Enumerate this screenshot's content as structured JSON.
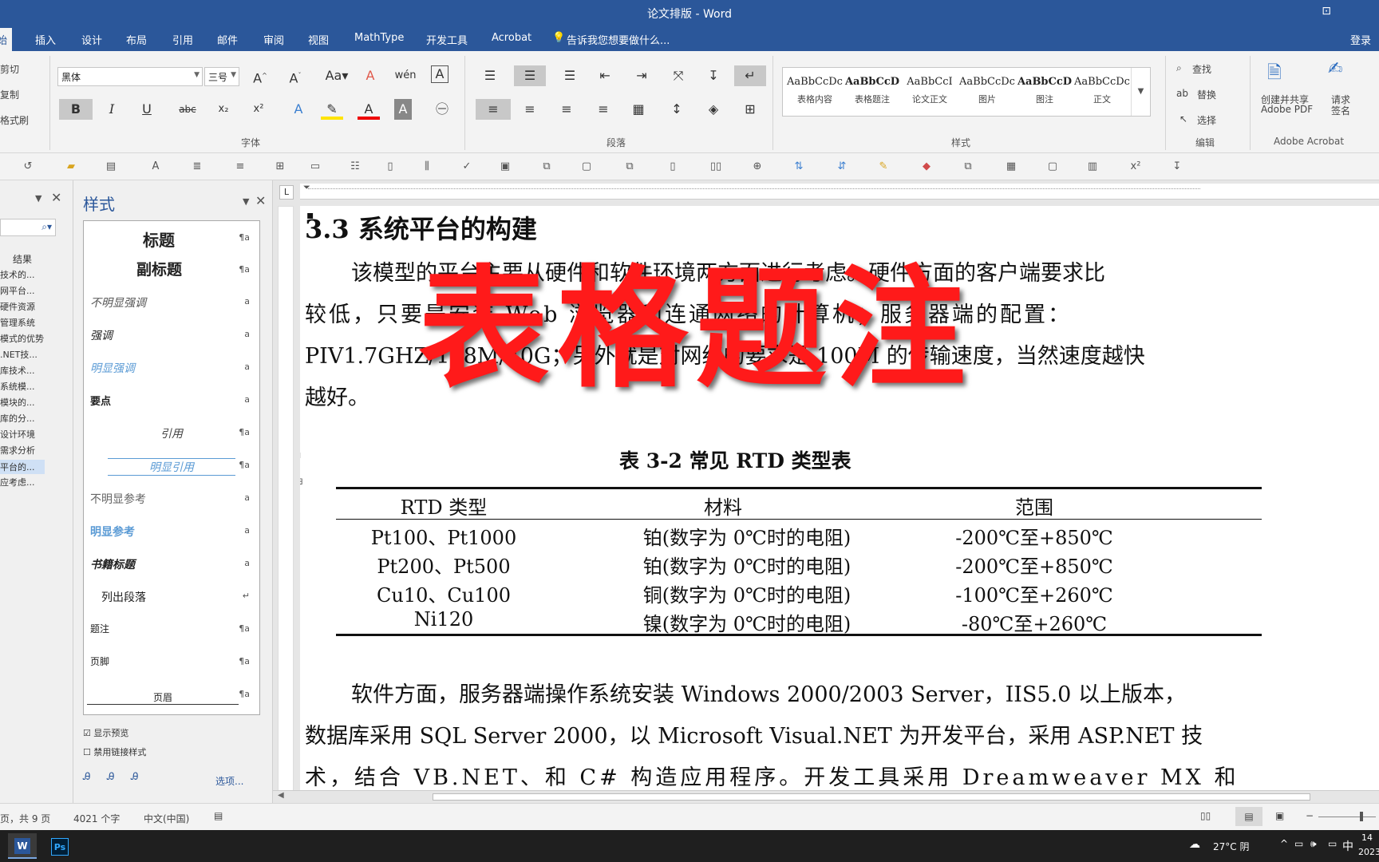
{
  "window": {
    "title": "论文排版 - Word"
  },
  "menu": {
    "items": [
      "始",
      "插入",
      "设计",
      "布局",
      "引用",
      "邮件",
      "审阅",
      "视图",
      "MathType",
      "开发工具",
      "Acrobat"
    ],
    "tell_me": "告诉我您想要做什么...",
    "login": "登录"
  },
  "ribbon": {
    "clipboard": {
      "cut": "剪切",
      "copy": "复制",
      "format_painter": "格式刷"
    },
    "font": {
      "name": "黑体",
      "size": "三号",
      "group_label": "字体",
      "bold": "B",
      "italic": "I",
      "underline": "U",
      "strike": "abc"
    },
    "paragraph": {
      "group_label": "段落"
    },
    "styles": {
      "group_label": "样式",
      "gallery": [
        {
          "preview": "AaBbCcDc",
          "name": "表格内容"
        },
        {
          "preview": "AaBbCcD",
          "name": "表格题注"
        },
        {
          "preview": "AaBbCcI",
          "name": "论文正文"
        },
        {
          "preview": "AaBbCcDc",
          "name": "图片"
        },
        {
          "preview": "AaBbCcD",
          "name": "图注"
        },
        {
          "preview": "AaBbCcDc",
          "name": "正文"
        }
      ]
    },
    "editing": {
      "find": "查找",
      "replace": "替换",
      "select": "选择",
      "group_label": "编辑"
    },
    "acrobat": {
      "create_share": "创建并共享",
      "create_share_2": "Adobe PDF",
      "request_sign": "请求",
      "request_sign_2": "签名",
      "group_label": "Adobe Acrobat"
    }
  },
  "nav_pane": {
    "results": "结果",
    "items": [
      "技术的...",
      "网平台...",
      "硬件资源",
      "管理系统",
      "模式的优势",
      ".NET技...",
      "库技术...",
      "系统模...",
      "模块的...",
      "库的分...",
      "设计环境",
      "需求分析",
      "平台的...",
      "应考虑..."
    ],
    "selected_index": 12
  },
  "styles_pane": {
    "title": "样式",
    "items": [
      {
        "name": "标题",
        "mark": "¶a"
      },
      {
        "name": "副标题",
        "mark": "¶a"
      },
      {
        "name": "不明显强调",
        "mark": "a"
      },
      {
        "name": "强调",
        "mark": "a"
      },
      {
        "name": "明显强调",
        "mark": "a"
      },
      {
        "name": "要点",
        "mark": "a"
      },
      {
        "name": "引用",
        "mark": "¶a"
      },
      {
        "name": "明显引用",
        "mark": "¶a"
      },
      {
        "name": "不明显参考",
        "mark": "a"
      },
      {
        "name": "明显参考",
        "mark": "a"
      },
      {
        "name": "书籍标题",
        "mark": "a"
      },
      {
        "name": "列出段落",
        "mark": "↵"
      },
      {
        "name": "题注",
        "mark": "¶a"
      },
      {
        "name": "页脚",
        "mark": "¶a"
      },
      {
        "name": "页眉",
        "mark": "¶a"
      }
    ],
    "show_preview": "显示预览",
    "disable_linked": "禁用链接样式",
    "options": "选项..."
  },
  "document": {
    "heading": "3.3 系统平台的构建",
    "para1": [
      "该模型的平台主要从硬件和软件环境两方面进行考虑。硬件方面的客户端要求比",
      "较低，只要是安装 Web 浏览器和连通网络的计算机；服务器端的配置：",
      "PIV1.7GHZ/128M/40G；另外就是对网络的要求是 100M 的传输速度，当然速度越快",
      "越好。"
    ],
    "table_caption": "表 3-2 常见 RTD 类型表",
    "table": {
      "headers": [
        "RTD 类型",
        "材料",
        "范围"
      ],
      "rows": [
        [
          "Pt100、Pt1000",
          "铂(数字为 0℃时的电阻)",
          "-200℃至+850℃"
        ],
        [
          "Pt200、Pt500",
          "铂(数字为 0℃时的电阻)",
          "-200℃至+850℃"
        ],
        [
          "Cu10、Cu100",
          "铜(数字为 0℃时的电阻)",
          "-100℃至+260℃"
        ],
        [
          "Ni120",
          "镍(数字为 0℃时的电阻)",
          "-80℃至+260℃"
        ]
      ]
    },
    "para2": [
      "软件方面，服务器端操作系统安装 Windows 2000/2003 Server，IIS5.0 以上版本，",
      "数据库采用 SQL Server 2000，以 Microsoft Visual.NET 为开发平台，采用 ASP.NET 技",
      "术，结合 VB.NET、和 C# 构造应用程序。开发工具采用 Dreamweaver MX 和"
    ],
    "overlay": "表格题注"
  },
  "status": {
    "pages": "页，共 9 页",
    "words": "4021 个字",
    "lang": "中文(中国)"
  },
  "taskbar": {
    "weather": "27°C 阴",
    "ime": "中",
    "time": "14",
    "date": "2023"
  }
}
